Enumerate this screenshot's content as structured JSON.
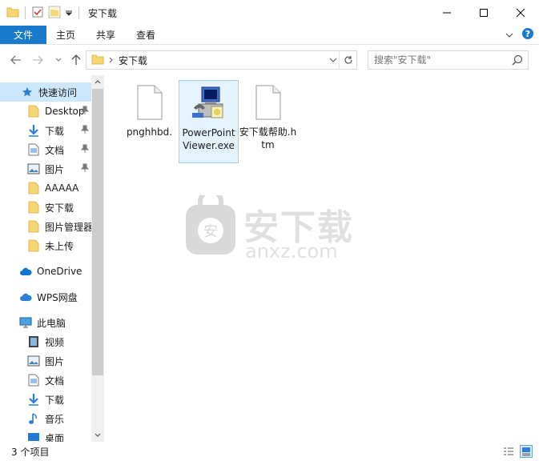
{
  "window": {
    "title": "安下载",
    "controls": [
      "minimize-icon",
      "maximize-icon",
      "close-icon"
    ]
  },
  "ribbon": {
    "tabs": [
      {
        "label": "文件",
        "active": true
      },
      {
        "label": "主页"
      },
      {
        "label": "共享"
      },
      {
        "label": "查看"
      }
    ]
  },
  "address": {
    "path": "安下载",
    "search_placeholder": "搜索\"安下载\""
  },
  "nav": {
    "items": [
      {
        "label": "快速访问",
        "icon": "star-icon",
        "selected": true
      },
      {
        "label": "Desktop",
        "icon": "folder-icon",
        "pinned": true
      },
      {
        "label": "下载",
        "icon": "download-icon",
        "pinned": true
      },
      {
        "label": "文档",
        "icon": "document-icon",
        "pinned": true
      },
      {
        "label": "图片",
        "icon": "pictures-icon",
        "pinned": true
      },
      {
        "label": "AAAAA",
        "icon": "folder-icon"
      },
      {
        "label": "安下载",
        "icon": "folder-icon"
      },
      {
        "label": "图片管理器",
        "icon": "folder-icon"
      },
      {
        "label": "未上传",
        "icon": "folder-icon"
      },
      {
        "label": "OneDrive",
        "icon": "cloud-icon"
      },
      {
        "label": "WPS网盘",
        "icon": "cloud-icon"
      },
      {
        "label": "此电脑",
        "icon": "computer-icon"
      },
      {
        "label": "视频",
        "icon": "video-icon"
      },
      {
        "label": "图片",
        "icon": "pictures-icon"
      },
      {
        "label": "文档",
        "icon": "document-icon"
      },
      {
        "label": "下载",
        "icon": "download-icon"
      },
      {
        "label": "音乐",
        "icon": "music-icon"
      },
      {
        "label": "桌面",
        "icon": "desktop-icon"
      }
    ]
  },
  "files": [
    {
      "name": "pnghhbd.",
      "icon": "blank-file-icon"
    },
    {
      "name": "PowerPointViewer.exe",
      "icon": "installer-icon",
      "selected": true
    },
    {
      "name": "安下载帮助.htm",
      "icon": "blank-file-icon"
    }
  ],
  "watermark": {
    "text": "安下载",
    "sub": "anxz.com"
  },
  "status": {
    "count": "3 个项目"
  },
  "colors": {
    "accent": "#1979ca",
    "selection": "#cce8ff",
    "folder": "#f7d674"
  }
}
